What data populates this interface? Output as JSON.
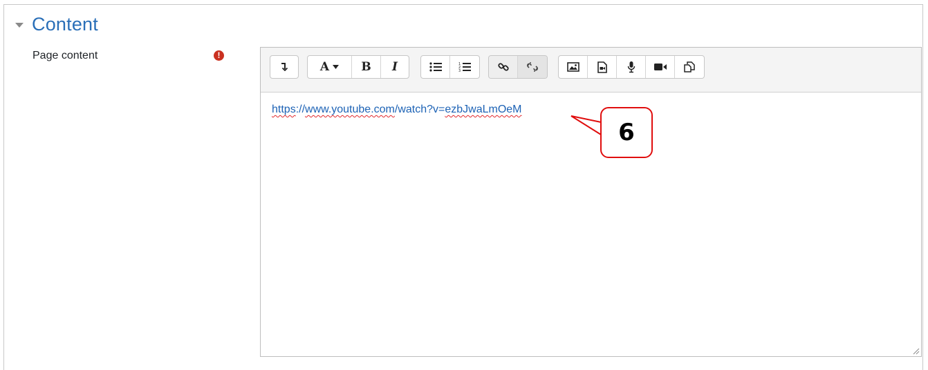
{
  "section": {
    "title": "Content",
    "caret_icon": "caret-down-icon"
  },
  "field": {
    "label": "Page content",
    "required_icon": "!"
  },
  "toolbar": {
    "buttons": [
      {
        "name": "show-more-buttons",
        "icon": "toggle-arrow-icon"
      },
      {
        "name": "text-style",
        "label": "A",
        "icon": "font-style-icon"
      },
      {
        "name": "bold",
        "label": "B",
        "icon": "bold-icon"
      },
      {
        "name": "italic",
        "label": "I",
        "icon": "italic-icon"
      },
      {
        "name": "unordered-list",
        "icon": "unordered-list-icon"
      },
      {
        "name": "ordered-list",
        "icon": "ordered-list-icon"
      },
      {
        "name": "link",
        "icon": "link-icon"
      },
      {
        "name": "unlink",
        "icon": "unlink-icon"
      },
      {
        "name": "insert-image",
        "icon": "image-icon"
      },
      {
        "name": "insert-media",
        "icon": "media-file-icon"
      },
      {
        "name": "record-audio",
        "icon": "microphone-icon"
      },
      {
        "name": "record-video",
        "icon": "video-camera-icon"
      },
      {
        "name": "manage-files",
        "icon": "copy-files-icon"
      }
    ]
  },
  "editor": {
    "link_part1": "https",
    "link_part2": "://",
    "link_part3": "www.youtube.com",
    "link_part4": "/watch?v=",
    "link_part5": "ezbJwaLmOeM"
  },
  "callout": {
    "label": "6",
    "color": "#e00d0d"
  },
  "colors": {
    "accent": "#2a6fb8",
    "link": "#1c62b5",
    "required": "#ca3120"
  }
}
